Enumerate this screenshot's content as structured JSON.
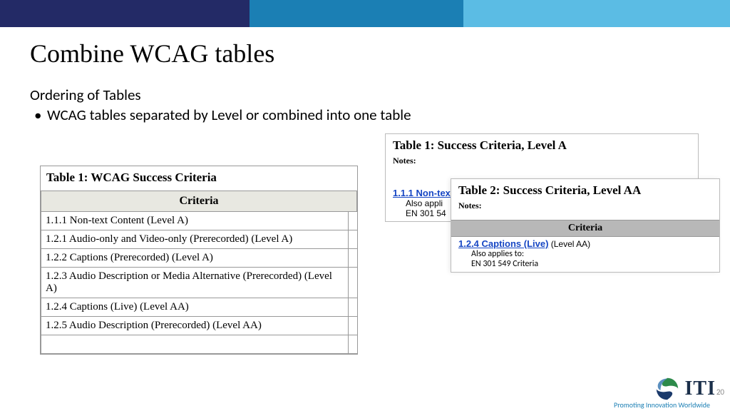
{
  "title": "Combine WCAG tables",
  "subtitle": "Ordering of Tables",
  "bullet": "WCAG tables separated by Level or combined into one table",
  "combined": {
    "title": "Table 1: WCAG Success Criteria",
    "header": "Criteria",
    "rows": [
      "1.1.1 Non-text Content (Level A)",
      "1.2.1 Audio-only and Video-only (Prerecorded) (Level A)",
      "1.2.2 Captions (Prerecorded) (Level A)",
      "1.2.3 Audio Description or Media Alternative (Prerecorded) (Level A)",
      "1.2.4 Captions (Live) (Level AA)",
      "1.2.5 Audio Description (Prerecorded) (Level AA)"
    ]
  },
  "levelA": {
    "title": "Table 1: Success Criteria, Level A",
    "notes_label": "Notes:",
    "link": "1.1.1 Non-tex",
    "sub1": "Also appli",
    "sub2": "EN 301 54"
  },
  "levelAA": {
    "title": "Table 2: Success Criteria, Level AA",
    "notes_label": "Notes:",
    "criteria_header": "Criteria",
    "link": "1.2.4 Captions (Live)",
    "level": " (Level AA)",
    "sub1": "Also applies to:",
    "sub2": "EN 301 549 Criteria"
  },
  "footer": {
    "brand": "ITI",
    "tagline": "Promoting Innovation Worldwide",
    "page": "20"
  }
}
